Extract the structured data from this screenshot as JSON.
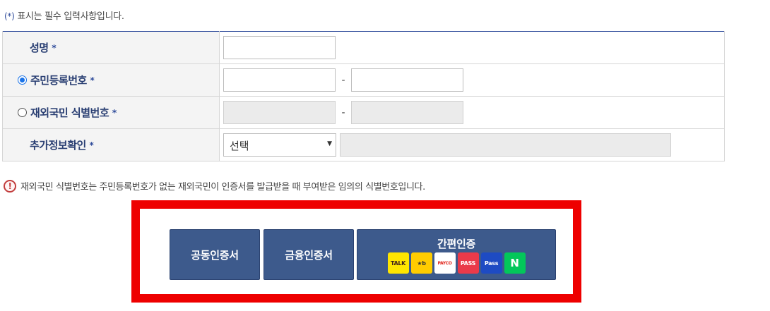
{
  "notes": {
    "required_star": "(*)",
    "required_text": "표시는 필수 입력사항입니다.",
    "star": "*"
  },
  "form": {
    "name_label": "성명",
    "rrn_label": "주민등록번호",
    "foreign_label": "재외국민 식별번호",
    "extra_label": "추가정보확인",
    "dash": "-",
    "select_value": "선택",
    "select_arrow": "▼",
    "radio_rrn_selected": true,
    "radio_foreign_selected": false
  },
  "notice": {
    "icon": "!",
    "text": "재외국민 식별번호는 주민등록번호가 없는 재외국민이 인증서를 발급받을 때 부여받은 임의의 식별번호입니다."
  },
  "auth": {
    "joint_cert_label": "공동인증서",
    "financial_cert_label": "금융인증서",
    "simple_auth_label": "간편인증",
    "providers": [
      {
        "icon": "kakao-talk-icon",
        "text": "TALK",
        "bg": "#fee500",
        "fg": "#3c1e1e"
      },
      {
        "icon": "kb-bank-icon",
        "text": "★b",
        "bg": "#ffcc00",
        "fg": "#333333"
      },
      {
        "icon": "payco-icon",
        "text": "PAYCO",
        "bg": "#ffffff",
        "fg": "#e1251b"
      },
      {
        "icon": "pass-icon",
        "text": "PASS",
        "bg": "#ea3a4a",
        "fg": "#ffffff"
      },
      {
        "icon": "samsung-pass-icon",
        "text": "Pass",
        "bg": "#1e4bc3",
        "fg": "#ffffff"
      },
      {
        "icon": "naver-icon",
        "text": "N",
        "bg": "#03c75a",
        "fg": "#ffffff"
      }
    ]
  },
  "colors": {
    "label_text": "#2a3f73",
    "button_bg": "#3d5a8c",
    "highlight_border": "#ee0000"
  }
}
